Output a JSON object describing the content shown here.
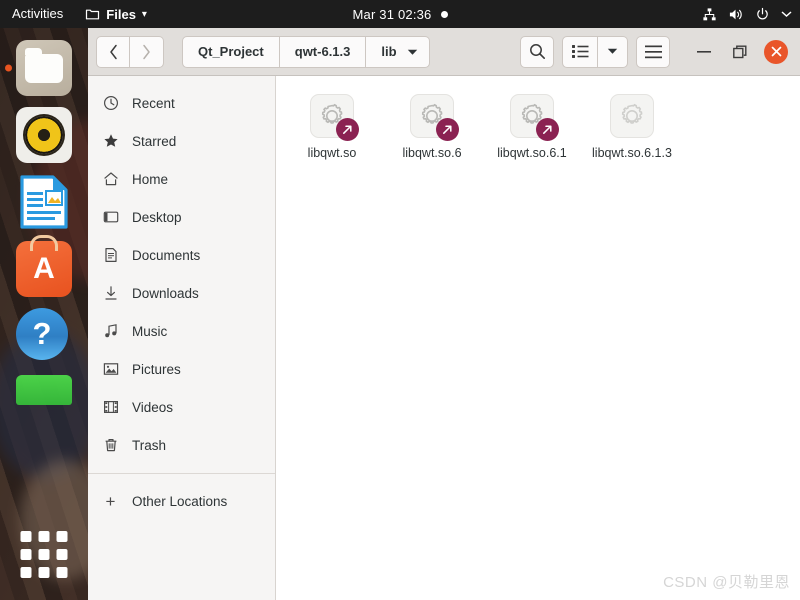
{
  "topbar": {
    "activities": "Activities",
    "app_name": "Files",
    "app_icon": "folder-icon",
    "app_menu_arrow": "▾",
    "clock": "Mar 31  02:36",
    "notification_dot": "notification-dot",
    "tray": [
      {
        "name": "network-icon"
      },
      {
        "name": "volume-icon"
      },
      {
        "name": "power-icon"
      },
      {
        "name": "chevron-down-icon"
      }
    ]
  },
  "dock": {
    "items": [
      {
        "name": "dock-item-files",
        "label": "Files",
        "running": true
      },
      {
        "name": "dock-item-rhythmbox",
        "label": "Rhythmbox",
        "running": false
      },
      {
        "name": "dock-item-libreoffice-writer",
        "label": "LibreOffice Writer",
        "running": false
      },
      {
        "name": "dock-item-ubuntu-software",
        "label": "Ubuntu Software",
        "running": false,
        "glyph": "A"
      },
      {
        "name": "dock-item-help",
        "label": "Help",
        "running": false,
        "glyph": "?"
      },
      {
        "name": "dock-item-app",
        "label": "Application",
        "running": false
      }
    ],
    "show_apps_label": "Show Applications"
  },
  "window": {
    "nav": {
      "back_label": "❬",
      "forward_label": "❭"
    },
    "breadcrumbs": [
      {
        "label": "Qt_Project"
      },
      {
        "label": "qwt-6.1.3"
      },
      {
        "label": "lib",
        "current": true,
        "arrow": "▾"
      }
    ],
    "actions": {
      "search_label": "search-icon",
      "view_list_label": "view-list-icon",
      "view_dropdown_label": "▾",
      "menu_label": "hamburger-menu-icon"
    },
    "controls": {
      "minimize": "–",
      "maximize": "maximize-icon",
      "close": "✕"
    }
  },
  "sidebar": {
    "items": [
      {
        "label": "Recent",
        "icon": "clock-icon",
        "name": "sidebar-item-recent"
      },
      {
        "label": "Starred",
        "icon": "star-icon",
        "name": "sidebar-item-starred"
      },
      {
        "label": "Home",
        "icon": "home-icon",
        "name": "sidebar-item-home"
      },
      {
        "label": "Desktop",
        "icon": "desktop-icon",
        "name": "sidebar-item-desktop"
      },
      {
        "label": "Documents",
        "icon": "document-icon",
        "name": "sidebar-item-documents"
      },
      {
        "label": "Downloads",
        "icon": "download-icon",
        "name": "sidebar-item-downloads"
      },
      {
        "label": "Music",
        "icon": "music-icon",
        "name": "sidebar-item-music"
      },
      {
        "label": "Pictures",
        "icon": "picture-icon",
        "name": "sidebar-item-pictures"
      },
      {
        "label": "Videos",
        "icon": "video-icon",
        "name": "sidebar-item-videos"
      },
      {
        "label": "Trash",
        "icon": "trash-icon",
        "name": "sidebar-item-trash"
      }
    ],
    "other_locations": {
      "label": "Other Locations",
      "icon": "plus-icon"
    }
  },
  "files": [
    {
      "name": "libqwt.so",
      "icon": "gear-icon",
      "symlink": true
    },
    {
      "name": "libqwt.so.6",
      "icon": "gear-icon",
      "symlink": true
    },
    {
      "name": "libqwt.so.6.1",
      "icon": "gear-icon",
      "symlink": true
    },
    {
      "name": "libqwt.so.6.1.3",
      "icon": "gear-icon",
      "symlink": false
    }
  ],
  "watermark": "CSDN @贝勒里恩",
  "colors": {
    "topbar_bg": "#1d1d1d",
    "headerbar_bg": "#e1dedb",
    "sidebar_bg": "#f6f5f4",
    "content_bg": "#ffffff",
    "close_button": "#e9552a",
    "symlink_badge": "#8b2252",
    "running_dot": "#e95420"
  }
}
